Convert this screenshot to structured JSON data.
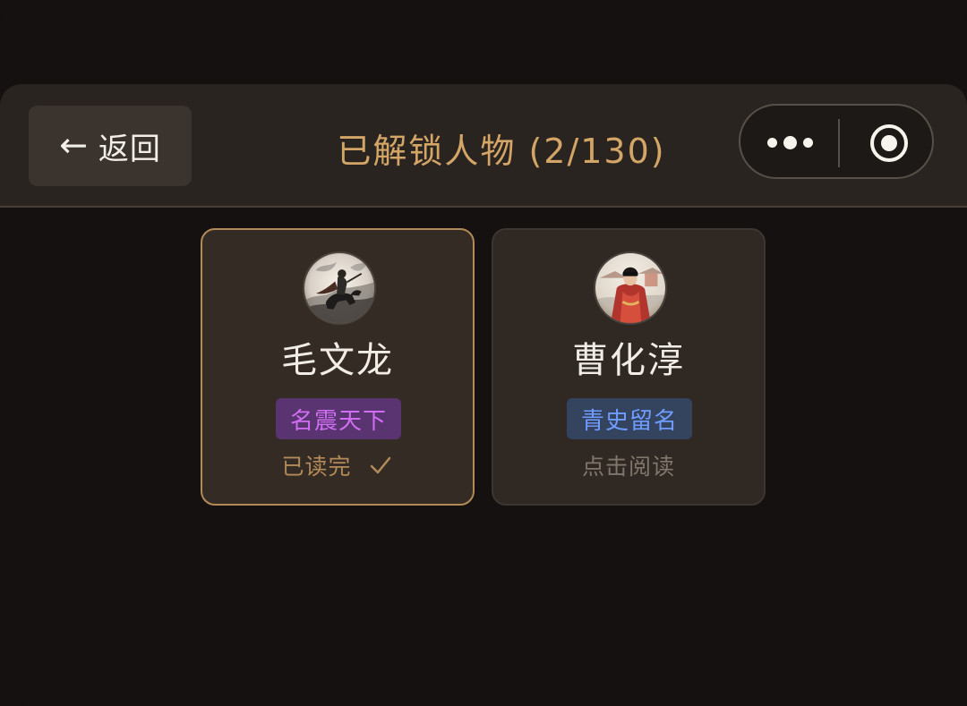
{
  "header": {
    "back_label": "返回",
    "title": "已解锁人物 (2/130)"
  },
  "icons": {
    "back": "arrow-left-icon",
    "more": "more-dots-icon",
    "target": "target-icon",
    "check": "check-icon"
  },
  "cards": [
    {
      "name": "毛文龙",
      "badge": "名震天下",
      "status": "已读完"
    },
    {
      "name": "曹化淳",
      "badge": "青史留名",
      "status": "点击阅读"
    }
  ],
  "colors": {
    "title_gold": "#d3a566",
    "purple_badge": "#d06ef1",
    "blue_badge": "#6f9cff"
  }
}
